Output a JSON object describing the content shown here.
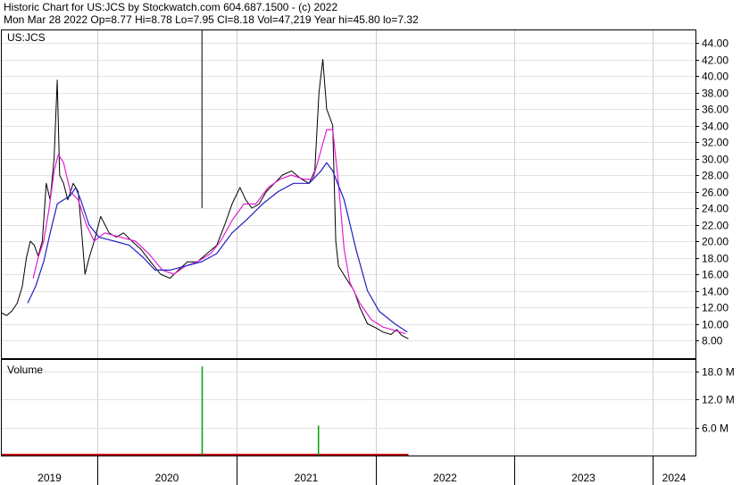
{
  "header": {
    "line1": "Historic Chart for US:JCS by Stockwatch.com 604.687.1500 - (c) 2022",
    "line2": "Mon Mar 28 2022  Op=8.77  Hi=8.78  Lo=7.95  Cl=8.18  Vol=47,219  Year hi=45.80  lo=7.32"
  },
  "chart_data": [
    {
      "type": "line",
      "title": "US:JCS",
      "price_ylabels": [
        "44.00",
        "42.00",
        "40.00",
        "38.00",
        "36.00",
        "34.00",
        "32.00",
        "30.00",
        "28.00",
        "26.00",
        "24.00",
        "22.00",
        "20.00",
        "18.00",
        "16.00",
        "14.00",
        "12.00",
        "10.00",
        "8.00"
      ],
      "ylim": [
        7,
        46
      ],
      "x_axis_years": [
        "2019",
        "2020",
        "2021",
        "2022",
        "2023",
        "2024"
      ],
      "grid": true,
      "series": [
        {
          "key": "price",
          "color": "#000000",
          "points": [
            [
              "2019-01-01",
              11.3
            ],
            [
              "2019-01-20",
              11.0
            ],
            [
              "2019-02-10",
              11.6
            ],
            [
              "2019-03-01",
              12.5
            ],
            [
              "2019-03-20",
              14.5
            ],
            [
              "2019-04-05",
              18.0
            ],
            [
              "2019-04-20",
              20.0
            ],
            [
              "2019-05-05",
              19.5
            ],
            [
              "2019-05-20",
              18.2
            ],
            [
              "2019-06-05",
              20.0
            ],
            [
              "2019-06-20",
              27.0
            ],
            [
              "2019-07-05",
              25.0
            ],
            [
              "2019-07-20",
              30.0
            ],
            [
              "2019-08-01",
              39.5
            ],
            [
              "2019-08-10",
              28.0
            ],
            [
              "2019-08-25",
              27.0
            ],
            [
              "2019-09-10",
              25.0
            ],
            [
              "2019-10-01",
              27.0
            ],
            [
              "2019-10-20",
              26.0
            ],
            [
              "2019-11-05",
              20.0
            ],
            [
              "2019-11-15",
              16.0
            ],
            [
              "2019-12-01",
              18.0
            ],
            [
              "2019-12-20",
              20.0
            ],
            [
              "2020-01-10",
              23.0
            ],
            [
              "2020-02-01",
              21.0
            ],
            [
              "2020-02-20",
              20.5
            ],
            [
              "2020-03-10",
              21.0
            ],
            [
              "2020-04-01",
              20.0
            ],
            [
              "2020-04-25",
              19.0
            ],
            [
              "2020-05-20",
              17.5
            ],
            [
              "2020-06-15",
              16.0
            ],
            [
              "2020-07-10",
              15.5
            ],
            [
              "2020-08-01",
              16.5
            ],
            [
              "2020-08-25",
              17.5
            ],
            [
              "2020-09-20",
              17.5
            ],
            [
              "2020-10-15",
              18.5
            ],
            [
              "2020-11-10",
              19.5
            ],
            [
              "2020-12-01",
              22.0
            ],
            [
              "2020-12-20",
              24.5
            ],
            [
              "2021-01-10",
              26.5
            ],
            [
              "2021-01-25",
              25.0
            ],
            [
              "2021-02-10",
              24.0
            ],
            [
              "2021-03-01",
              24.5
            ],
            [
              "2021-03-20",
              26.0
            ],
            [
              "2021-04-10",
              27.0
            ],
            [
              "2021-05-01",
              28.0
            ],
            [
              "2021-05-25",
              28.5
            ],
            [
              "2021-06-20",
              27.5
            ],
            [
              "2021-07-10",
              27.0
            ],
            [
              "2021-07-25",
              28.5
            ],
            [
              "2021-08-05",
              38.0
            ],
            [
              "2021-08-15",
              42.0
            ],
            [
              "2021-08-25",
              36.0
            ],
            [
              "2021-09-10",
              34.0
            ],
            [
              "2021-09-18",
              20.0
            ],
            [
              "2021-09-25",
              17.0
            ],
            [
              "2021-10-15",
              15.5
            ],
            [
              "2021-11-05",
              14.0
            ],
            [
              "2021-11-20",
              12.0
            ],
            [
              "2021-12-10",
              10.0
            ],
            [
              "2022-01-01",
              9.5
            ],
            [
              "2022-01-20",
              9.0
            ],
            [
              "2022-02-10",
              8.7
            ],
            [
              "2022-02-25",
              9.3
            ],
            [
              "2022-03-10",
              8.6
            ],
            [
              "2022-03-28",
              8.18
            ]
          ]
        },
        {
          "key": "ma_short",
          "color": "#e020d0",
          "points": [
            [
              "2019-05-01",
              15.5
            ],
            [
              "2019-05-20",
              18.0
            ],
            [
              "2019-06-10",
              20.0
            ],
            [
              "2019-07-01",
              24.0
            ],
            [
              "2019-07-20",
              28.5
            ],
            [
              "2019-08-05",
              30.5
            ],
            [
              "2019-08-25",
              29.5
            ],
            [
              "2019-09-20",
              26.0
            ],
            [
              "2019-10-20",
              25.0
            ],
            [
              "2019-11-20",
              22.0
            ],
            [
              "2019-12-20",
              20.0
            ],
            [
              "2020-01-20",
              21.0
            ],
            [
              "2020-03-01",
              20.5
            ],
            [
              "2020-04-10",
              20.0
            ],
            [
              "2020-05-15",
              18.5
            ],
            [
              "2020-06-20",
              16.5
            ],
            [
              "2020-07-20",
              16.0
            ],
            [
              "2020-08-20",
              17.0
            ],
            [
              "2020-09-20",
              17.5
            ],
            [
              "2020-10-25",
              18.5
            ],
            [
              "2020-11-20",
              20.0
            ],
            [
              "2020-12-20",
              22.5
            ],
            [
              "2021-01-20",
              24.5
            ],
            [
              "2021-02-20",
              24.5
            ],
            [
              "2021-03-25",
              26.5
            ],
            [
              "2021-04-25",
              27.5
            ],
            [
              "2021-05-25",
              28.0
            ],
            [
              "2021-06-25",
              27.5
            ],
            [
              "2021-07-20",
              27.5
            ],
            [
              "2021-08-10",
              31.0
            ],
            [
              "2021-08-25",
              33.5
            ],
            [
              "2021-09-10",
              33.5
            ],
            [
              "2021-09-25",
              27.0
            ],
            [
              "2021-10-10",
              19.0
            ],
            [
              "2021-10-25",
              15.0
            ],
            [
              "2021-11-20",
              12.5
            ],
            [
              "2021-12-20",
              10.5
            ],
            [
              "2022-01-20",
              9.6
            ],
            [
              "2022-02-20",
              9.2
            ],
            [
              "2022-03-20",
              8.8
            ]
          ]
        },
        {
          "key": "ma_long",
          "color": "#2020c0",
          "points": [
            [
              "2019-04-10",
              12.5
            ],
            [
              "2019-05-10",
              14.5
            ],
            [
              "2019-06-10",
              17.5
            ],
            [
              "2019-07-05",
              21.0
            ],
            [
              "2019-08-01",
              24.5
            ],
            [
              "2019-08-25",
              25.0
            ],
            [
              "2019-09-20",
              25.5
            ],
            [
              "2019-10-10",
              26.5
            ],
            [
              "2019-10-30",
              25.0
            ],
            [
              "2019-11-30",
              22.0
            ],
            [
              "2020-01-05",
              20.5
            ],
            [
              "2020-02-15",
              20.0
            ],
            [
              "2020-03-25",
              19.5
            ],
            [
              "2020-05-01",
              18.0
            ],
            [
              "2020-06-01",
              16.5
            ],
            [
              "2020-07-10",
              16.5
            ],
            [
              "2020-08-20",
              17.0
            ],
            [
              "2020-10-01",
              17.5
            ],
            [
              "2020-11-10",
              18.5
            ],
            [
              "2020-12-20",
              21.0
            ],
            [
              "2021-01-25",
              22.5
            ],
            [
              "2021-03-10",
              24.5
            ],
            [
              "2021-04-20",
              26.0
            ],
            [
              "2021-05-30",
              27.0
            ],
            [
              "2021-07-10",
              27.0
            ],
            [
              "2021-08-10",
              28.5
            ],
            [
              "2021-08-25",
              29.5
            ],
            [
              "2021-09-10",
              28.5
            ],
            [
              "2021-10-10",
              25.0
            ],
            [
              "2021-11-10",
              19.0
            ],
            [
              "2021-12-10",
              14.0
            ],
            [
              "2022-01-10",
              11.5
            ],
            [
              "2022-02-20",
              10.0
            ],
            [
              "2022-03-25",
              9.0
            ]
          ]
        }
      ]
    },
    {
      "type": "bar",
      "title": "Volume",
      "volume_ylabels": [
        "18.0 M",
        "12.0 M",
        "6.0 M"
      ],
      "ylim": [
        0,
        20000000
      ],
      "baseline_color": "#c80000",
      "spike_color": "#00a000",
      "spikes": [
        [
          "2020-10-02",
          19000000
        ],
        [
          "2021-08-03",
          6400000
        ]
      ],
      "small_bars_until": "2022-03-28"
    }
  ]
}
